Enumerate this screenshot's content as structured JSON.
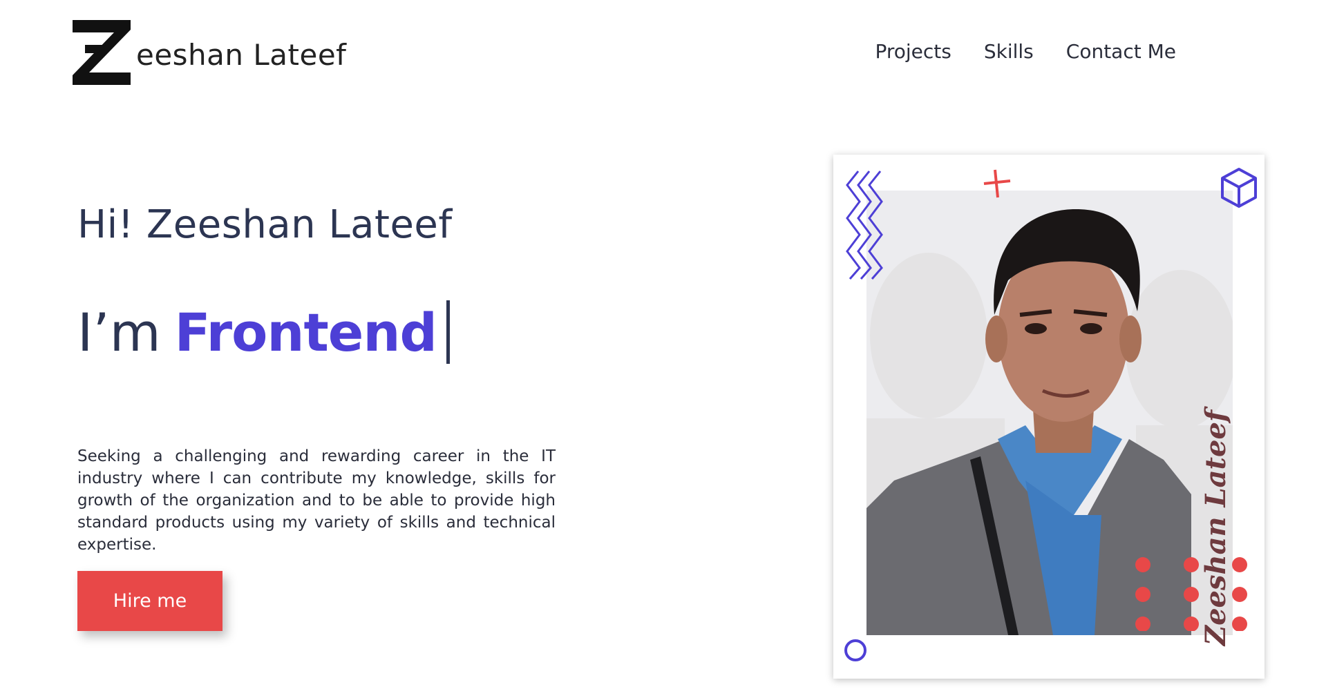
{
  "header": {
    "logo_text": "eeshan Lateef",
    "nav": [
      {
        "label": "Projects"
      },
      {
        "label": "Skills"
      },
      {
        "label": "Contact Me"
      }
    ]
  },
  "hero": {
    "greeting": "Hi! Zeeshan Lateef",
    "role_prefix": "I’m",
    "role_highlight": "Frontend",
    "bio": "Seeking a challenging and rewarding career in the IT industry where I can contribute my knowledge, skills for growth of the organization and to be able to provide high standard products using my variety of skills and technical expertise.",
    "cta_label": "Hire me"
  },
  "profile_card": {
    "signature": "Zeeshan Lateef"
  },
  "colors": {
    "accent": "#4d3fd6",
    "button": "#e84848",
    "text": "#2c3552",
    "dots": "#e84848"
  },
  "icons": [
    "logo-z-icon",
    "zigzag-icon",
    "plus-icon",
    "cube-icon",
    "circle-icon",
    "dots-icon"
  ]
}
